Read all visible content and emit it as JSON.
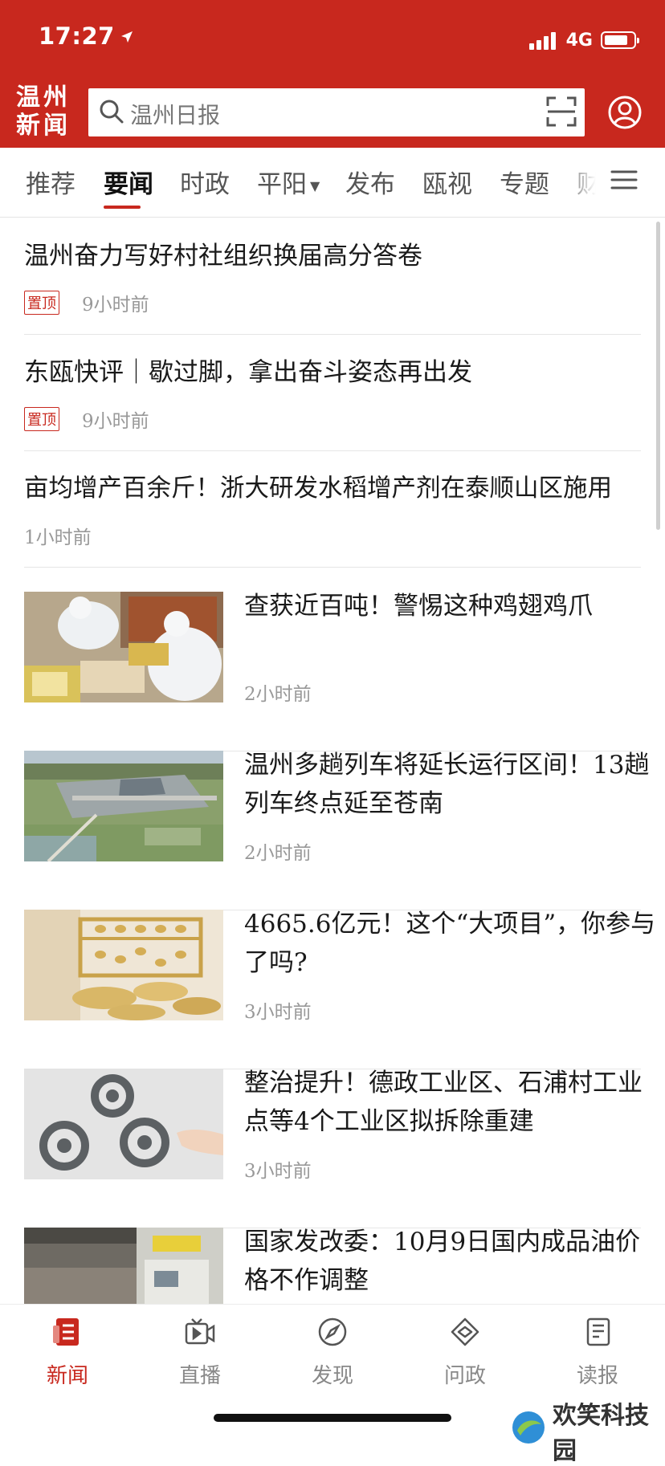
{
  "status_bar": {
    "time": "17:27",
    "network": "4G"
  },
  "app": {
    "logo_line1": "温州",
    "logo_line2": "新闻"
  },
  "search": {
    "placeholder": "温州日报"
  },
  "tabs": [
    {
      "label": "推荐"
    },
    {
      "label": "要闻"
    },
    {
      "label": "时政"
    },
    {
      "label": "平阳"
    },
    {
      "label": "发布"
    },
    {
      "label": "瓯视"
    },
    {
      "label": "专题"
    },
    {
      "label": "财"
    }
  ],
  "active_tab": "要闻",
  "text_articles": [
    {
      "title": "温州奋力写好村社组织换届高分答卷",
      "badge": "置顶",
      "time": "9小时前"
    },
    {
      "title": "东瓯快评｜歇过脚，拿出奋斗姿态再出发",
      "badge": "置顶",
      "time": "9小时前"
    },
    {
      "title": "亩均增产百余斤！浙大研发水稻增产剂在泰顺山区施用",
      "time": "1小时前"
    }
  ],
  "image_articles": [
    {
      "title": "查获近百吨！警惕这种鸡翅鸡爪",
      "time": "2小时前"
    },
    {
      "title": "温州多趟列车将延长运行区间！13趟列车终点延至苍南",
      "time": "2小时前"
    },
    {
      "title": "4665.6亿元！这个“大项目”，你参与了吗?",
      "time": "3小时前"
    },
    {
      "title": "整治提升！德政工业区、石浦村工业点等4个工业区拟拆除重建",
      "time": "3小时前"
    },
    {
      "title": "国家发改委：10月9日国内成品油价格不作调整",
      "time": ""
    }
  ],
  "bottom_nav": [
    {
      "label": "新闻",
      "icon": "news-icon",
      "active": true
    },
    {
      "label": "直播",
      "icon": "live-icon",
      "active": false
    },
    {
      "label": "发现",
      "icon": "compass-icon",
      "active": false
    },
    {
      "label": "问政",
      "icon": "handshake-icon",
      "active": false
    },
    {
      "label": "读报",
      "icon": "newspaper-icon",
      "active": false
    }
  ],
  "watermark": "欢笑科技园",
  "colors": {
    "brand_red": "#c8281e",
    "text_gray": "#999999"
  }
}
